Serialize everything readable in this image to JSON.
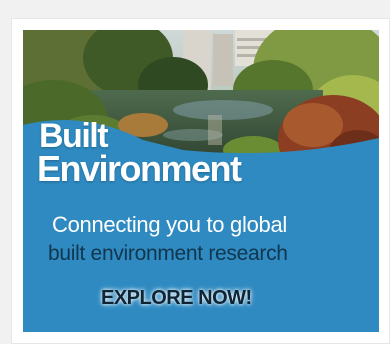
{
  "banner": {
    "brand_line1": "Built",
    "brand_line2": "Environment",
    "tagline_line1": "Connecting you to global",
    "tagline_line2": "built environment research",
    "cta_label": "EXPLORE NOW!",
    "colors": {
      "panel_blue": "#2e8ac1",
      "tagline_dark": "#12364e",
      "text_white": "#ffffff"
    }
  }
}
